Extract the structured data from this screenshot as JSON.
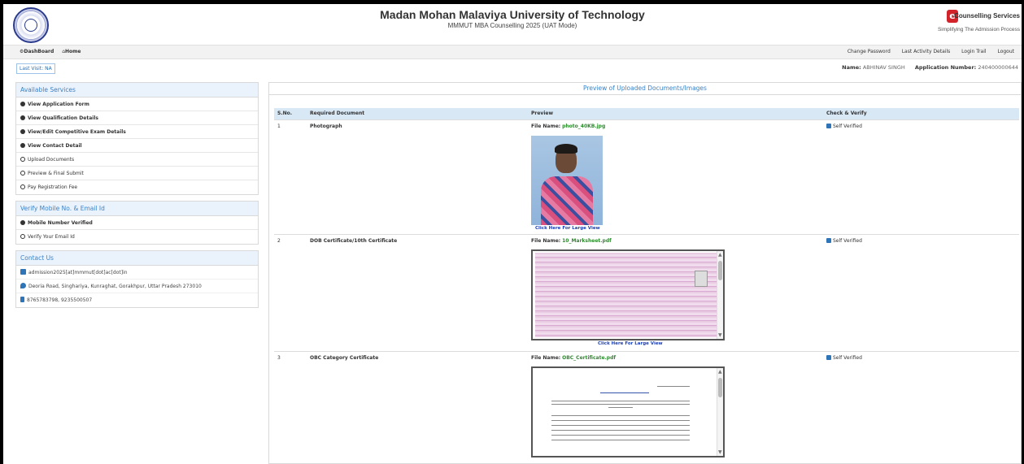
{
  "header": {
    "title": "Madan Mohan Malaviya University of Technology",
    "subtitle": "MMMUT MBA Counselling 2025 (UAT Mode)",
    "brand_name": "-Counselling Services",
    "brand_tagline": "Simplifying The Admission Process",
    "brand_letter": "e"
  },
  "nav": {
    "dashboard": "DashBoard",
    "home": "Home",
    "change_password": "Change Password",
    "last_activity": "Last Activity Details",
    "login_trail": "Login Trail",
    "logout": "Logout"
  },
  "visit": {
    "last_visit": "Last Visit: NA",
    "name_label": "Name:",
    "name_value": "ABHINAV SINGH",
    "app_label": "Application Number:",
    "app_value": "240400000644"
  },
  "services": {
    "heading": "Available Services",
    "items": [
      {
        "label": "View Application Form",
        "filled": true
      },
      {
        "label": "View Qualification Details",
        "filled": true
      },
      {
        "label": "View/Edit Competitive Exam Details",
        "filled": true
      },
      {
        "label": "View Contact Detail",
        "filled": true
      },
      {
        "label": "Upload Documents",
        "filled": false
      },
      {
        "label": "Preview & Final Submit",
        "filled": false
      },
      {
        "label": "Pay Registration Fee",
        "filled": false
      }
    ]
  },
  "verify": {
    "heading": "Verify Mobile No. & Email Id",
    "items": [
      {
        "label": "Mobile Number Verified",
        "filled": true
      },
      {
        "label": "Verify Your Email Id",
        "filled": false
      }
    ]
  },
  "contact": {
    "heading": "Contact Us",
    "email": "admission2025[at]mmmut[dot]ac[dot]in",
    "address": "Deoria Road, Singhariya, Kunraghat, Gorakhpur, Uttar Pradesh 273010",
    "phone": "8765783798, 9235500507"
  },
  "main": {
    "heading": "Preview of Uploaded Documents/Images",
    "columns": [
      "S.No.",
      "Required Document",
      "Preview",
      "Check & Verify"
    ],
    "file_name_label": "File Name:",
    "large_view": "Click Here For Large View",
    "verified_label": "Self Verified",
    "rows": [
      {
        "sno": "1",
        "doc": "Photograph",
        "file": "photo_40KB.jpg"
      },
      {
        "sno": "2",
        "doc": "DOB Certificate/10th Certificate",
        "file": "10_Marksheet.pdf"
      },
      {
        "sno": "3",
        "doc": "OBC Category Certificate",
        "file": "OBC_Certificate.pdf"
      }
    ]
  }
}
